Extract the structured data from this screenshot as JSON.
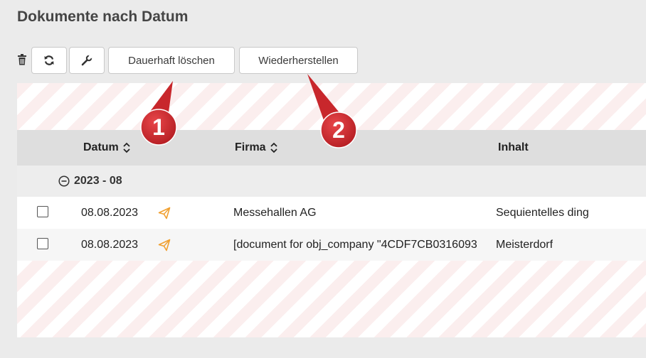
{
  "page": {
    "title": "Dokumente nach Datum"
  },
  "toolbar": {
    "delete_label": "Dauerhaft löschen",
    "restore_label": "Wiederherstellen"
  },
  "table": {
    "columns": {
      "date": "Datum",
      "company": "Firma",
      "content": "Inhalt"
    },
    "group": {
      "label": "2023 - 08"
    },
    "rows": [
      {
        "date": "08.08.2023",
        "company": "Messehallen AG",
        "content": "Sequientelles ding"
      },
      {
        "date": "08.08.2023",
        "company": "[document for obj_company \"4CDF7CB0316093",
        "content": "Meisterdorf"
      }
    ]
  },
  "annotations": {
    "marker1": "1",
    "marker2": "2"
  },
  "colors": {
    "accent_send": "#f0a030",
    "callout_red": "#c8272c",
    "stripe": "#fbeeee"
  },
  "icons": [
    "trash-icon",
    "refresh-icon",
    "wrench-icon",
    "sort-icon",
    "collapse-icon",
    "send-icon"
  ]
}
